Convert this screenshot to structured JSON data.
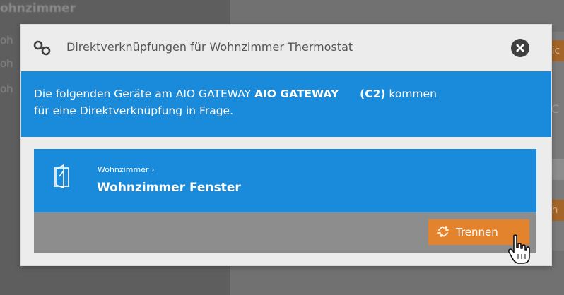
{
  "background": {
    "title": "ohnzimmer",
    "fragments": [
      "oh",
      "oh",
      "oh"
    ],
    "right_fragments": [
      "eic",
      "eh",
      "C"
    ]
  },
  "dialog": {
    "header_icon": "link-icon",
    "title": "Direktverknüpfungen für Wohnzimmer Thermostat",
    "close_icon": "close-icon",
    "info": {
      "text_before": "Die folgenden Geräte am AIO GATEWAY ",
      "gateway_name": "AIO GATEWAY",
      "channel": "(C2)",
      "text_after": " kommen",
      "line2": "für eine Direktverknüpfung in Frage."
    },
    "device": {
      "icon": "window-icon",
      "room": "Wohnzimmer ›",
      "name": "Wohnzimmer Fenster",
      "unlink_label": "Trennen",
      "unlink_icon": "unlink-icon"
    }
  },
  "colors": {
    "accent_blue": "#1a8bdb",
    "button_orange": "#e4832e",
    "overlay_gray": "#6c6c6c"
  }
}
